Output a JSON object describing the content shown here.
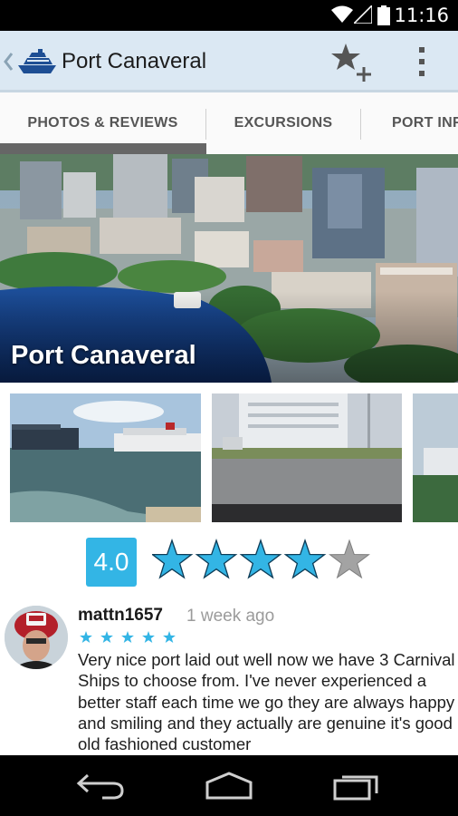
{
  "status_bar": {
    "time": "11:16",
    "icons": [
      "wifi-icon",
      "signal-icon",
      "battery-icon"
    ]
  },
  "action_bar": {
    "title": "Port Canaveral",
    "logo_icon": "cruise-ship-icon",
    "actions": [
      "star-add-icon",
      "overflow-menu-icon"
    ]
  },
  "tabs": [
    {
      "label": "PHOTOS & REVIEWS",
      "selected": true
    },
    {
      "label": "EXCURSIONS",
      "selected": false
    },
    {
      "label": "PORT INFO",
      "selected": false
    }
  ],
  "hero": {
    "title": "Port Canaveral"
  },
  "photos": [
    "cruise-ships-harbor-photo",
    "cruise-ship-dock-photo",
    "cruise-ship-trees-photo"
  ],
  "rating": {
    "value": "4.0",
    "stars_filled": 4,
    "stars_total": 5
  },
  "review": {
    "author": "mattn1657",
    "time": "1 week ago",
    "stars": 5,
    "text": "Very nice port laid out well now we have 3 Carnival Ships to choose from. I've never experienced a better staff each time we go they are always happy and smiling and they actually are genuine it's good old fashioned customer"
  },
  "colors": {
    "accent": "#33b5e5",
    "action_bar": "#dbe8f3",
    "status_bar": "#000000"
  },
  "nav_bar": {
    "buttons": [
      "back-icon",
      "home-icon",
      "recent-apps-icon"
    ]
  }
}
